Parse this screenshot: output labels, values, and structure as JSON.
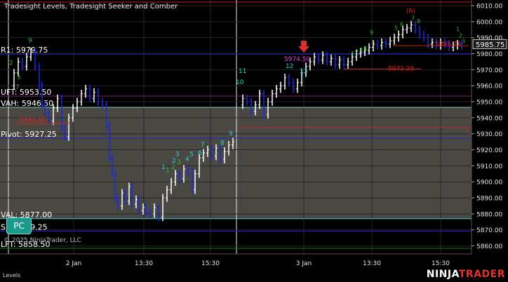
{
  "window": {
    "plot_title": "Tradesight Levels, Tradesight Seeker and Comber",
    "copyright": "© 2025 NinjaTrader, LLC",
    "tab_label": "Levels",
    "pc_button": "PC",
    "brand_ninja": "NINJA",
    "brand_trader": "TRADER"
  },
  "price_axis": {
    "ticks": [
      "6010.00",
      "6000.00",
      "5990.00",
      "5980.00",
      "5970.00",
      "5960.00",
      "5950.00",
      "5940.00",
      "5930.00",
      "5920.00",
      "5910.00",
      "5900.00",
      "5890.00",
      "5880.00",
      "5870.00",
      "5860.00"
    ],
    "last_price": "5985.75",
    "last_price_color": "#ffffff"
  },
  "time_axis": {
    "ticks": [
      "2 Jan",
      "13:30",
      "15:30",
      "3 Jan",
      "13:30",
      "15:30"
    ]
  },
  "levels": [
    {
      "label": "R1: 5979.75",
      "price": 5979.75,
      "color": "#2020d0",
      "label_color": "#ffffff"
    },
    {
      "label": "UFT: 5953.50",
      "price": 5953.5,
      "color": "#8a1c6a",
      "label_color": "#ffffff"
    },
    {
      "label": "VAH: 5946.50",
      "price": 5946.5,
      "color": "#6fcfbf",
      "label_color": "#ffffff"
    },
    {
      "label": "Pivot: 5927.25",
      "price": 5927.25,
      "color": "#2020d0",
      "label_color": "#ffffff"
    },
    {
      "label": "VAL: 5877.00",
      "price": 5877.0,
      "color": "#3fd0d0",
      "label_color": "#ffffff"
    },
    {
      "label": "S1: 5869.25",
      "price": 5869.25,
      "color": "#2020d0",
      "label_color": "#ffffff"
    },
    {
      "label": "LFT: 5858.50",
      "price": 5858.5,
      "color": "#1a7a1a",
      "label_color": "#ffffff"
    }
  ],
  "annotations": [
    {
      "text": "5974.50",
      "color": "#e040e0"
    },
    {
      "text": "5971.25",
      "color": "#e02020"
    },
    {
      "text": "5985.75",
      "color": "#e02020"
    },
    {
      "text": "5941.50",
      "color": "#e02020"
    },
    {
      "text": "(R)",
      "color": "#e02020"
    }
  ],
  "seeker_counts_day1_green": [
    "9",
    "2",
    "5",
    "7",
    "1",
    "2",
    "3"
  ],
  "seeker_counts_day1_cyan": [
    "1",
    "2",
    "3",
    "4",
    "5",
    "6",
    "7",
    "8",
    "9"
  ],
  "seeker_counts_day2_cyan": [
    "10",
    "11",
    "12",
    "13"
  ],
  "seeker_counts_day2_green": [
    "9",
    "1",
    "2",
    "3",
    "4",
    "5",
    "6",
    "7",
    "8"
  ],
  "colors": {
    "value_area_fill": "#4a4842",
    "background": "#000000",
    "bar_up": "#ffffff",
    "bar_down": "#1a28e0",
    "grid": "#262626"
  }
}
